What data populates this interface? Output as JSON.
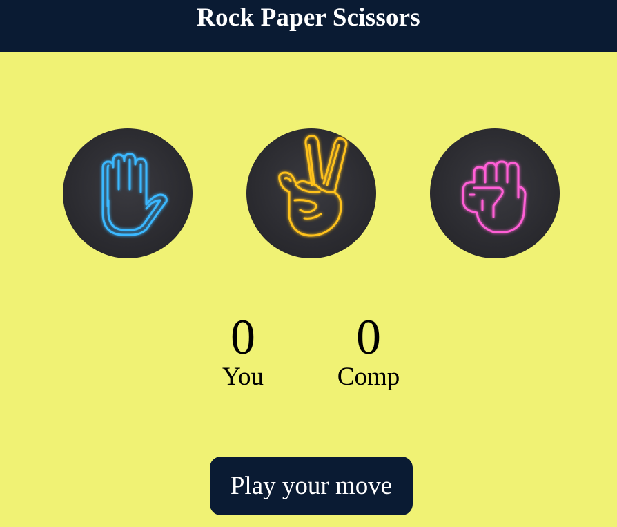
{
  "header": {
    "title": "Rock Paper Scissors",
    "background": "#0a1b33"
  },
  "page": {
    "background": "#f0f274"
  },
  "choices": [
    {
      "name": "paper",
      "icon": "open-hand-icon",
      "glow_color": "#3ab8ff"
    },
    {
      "name": "scissors",
      "icon": "peace-hand-icon",
      "glow_color": "#ffc21a"
    },
    {
      "name": "rock",
      "icon": "fist-icon",
      "glow_color": "#ff5ed6"
    }
  ],
  "scoreboard": {
    "user": {
      "score": "0",
      "label": "You"
    },
    "computer": {
      "score": "0",
      "label": "Comp"
    }
  },
  "action": {
    "label": "Play your move"
  }
}
